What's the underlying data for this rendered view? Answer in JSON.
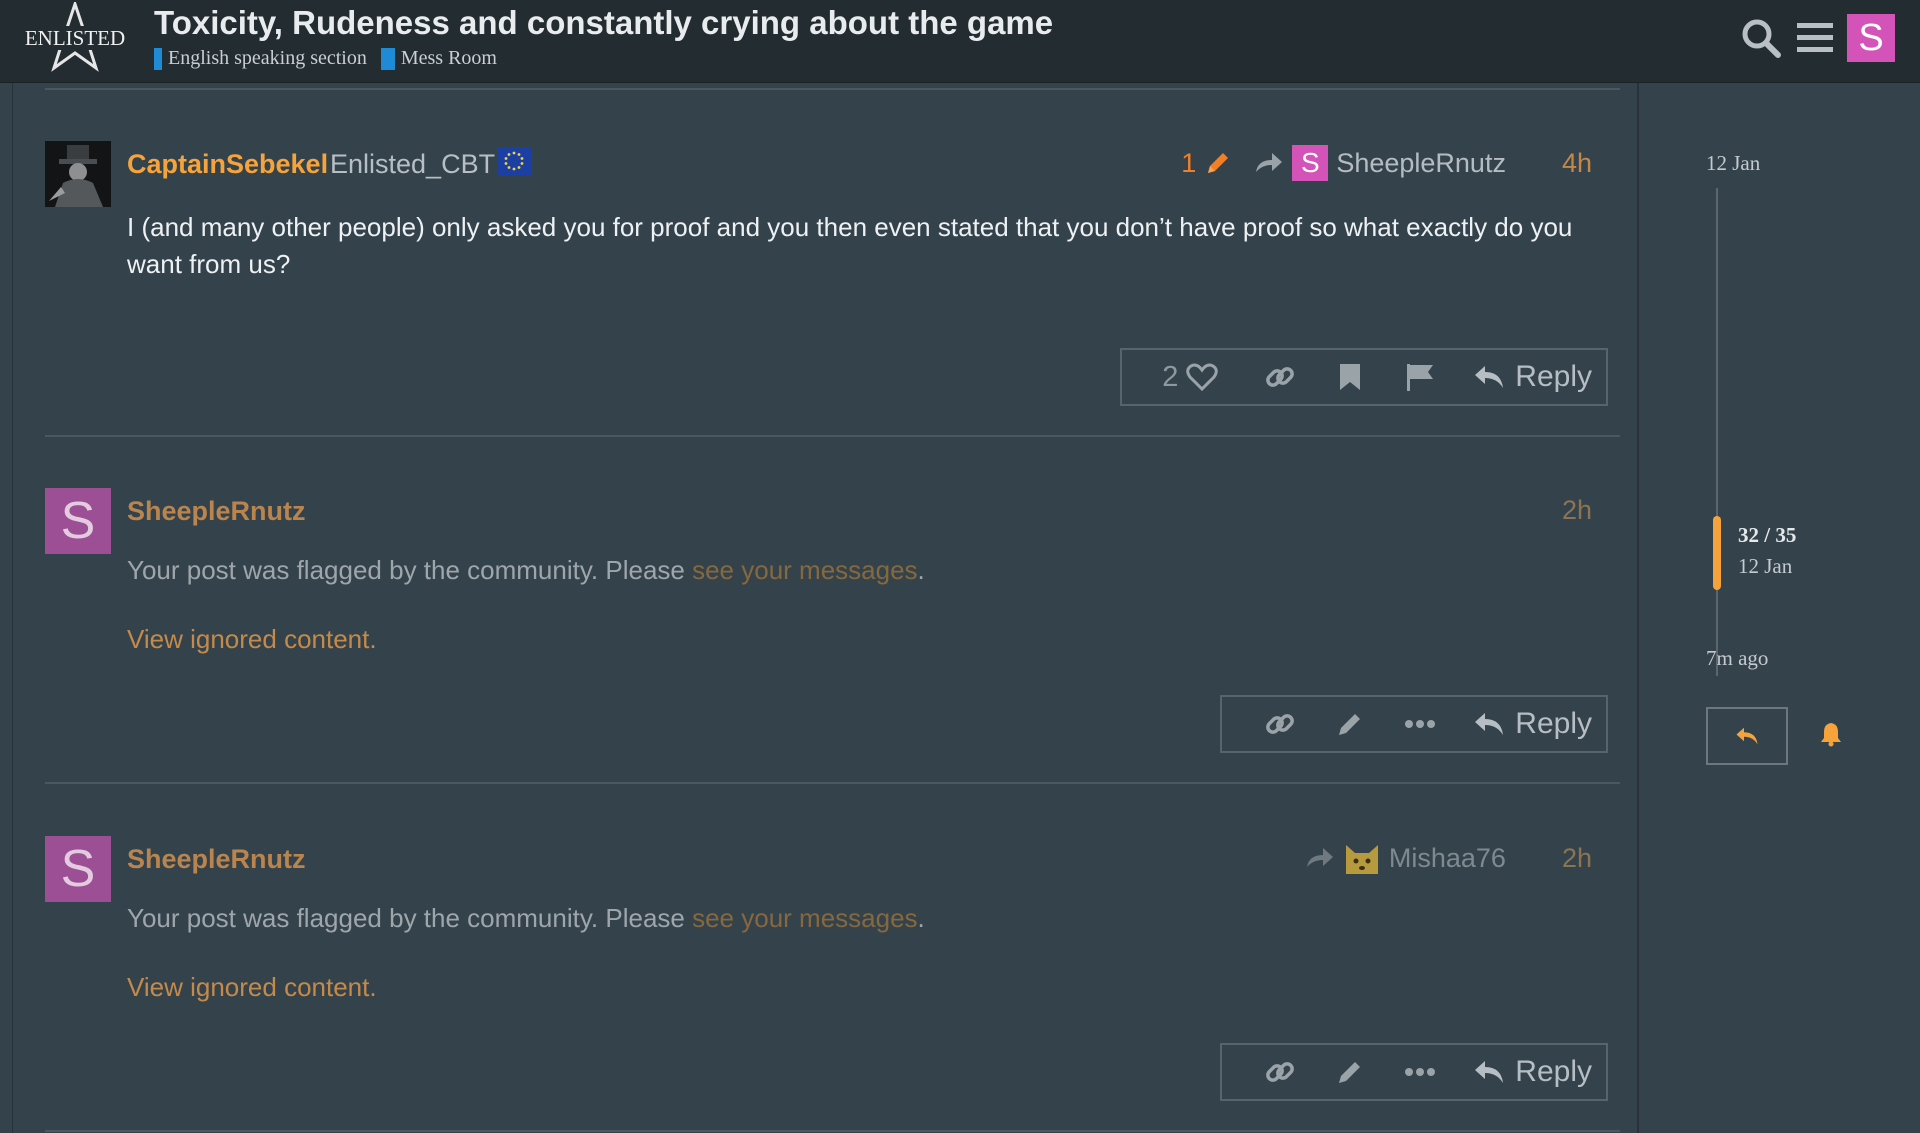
{
  "header": {
    "logo_text": "ENLISTED",
    "topic_title": "Toxicity, Rudeness and constantly crying about the game",
    "categories": [
      "English speaking section",
      "Mess Room"
    ],
    "user_avatar_letter": "S",
    "colors": {
      "accent": "#f7a33b",
      "category": "#1f8ad6",
      "avatar": "#d453b9"
    }
  },
  "posts": [
    {
      "username": "CaptainSebekel",
      "user_title": "Enlisted_CBT",
      "edit_count": "1",
      "reply_to": {
        "avatar_letter": "S",
        "name": "SheepleRnutz"
      },
      "date": "4h",
      "body": "I (and many other people) only asked you for proof and you then even stated that you don’t have proof so what exactly do you want from us?",
      "like_count": "2",
      "reply_label": "Reply"
    },
    {
      "avatar_letter": "S",
      "username": "SheepleRnutz",
      "date": "2h",
      "flag_text": "Your post was flagged by the community. Please ",
      "flag_link": "see your messages",
      "flag_end": ".",
      "ignored_label": "View ignored content.",
      "reply_label": "Reply"
    },
    {
      "avatar_letter": "S",
      "username": "SheepleRnutz",
      "reply_to": {
        "name": "Mishaa76"
      },
      "date": "2h",
      "flag_text": "Your post was flagged by the community. Please ",
      "flag_link": "see your messages",
      "flag_end": ".",
      "ignored_label": "View ignored content.",
      "reply_label": "Reply"
    }
  ],
  "timeline": {
    "start_date": "12 Jan",
    "position": "32 / 35",
    "position_date": "12 Jan",
    "end_label": "7m ago"
  }
}
